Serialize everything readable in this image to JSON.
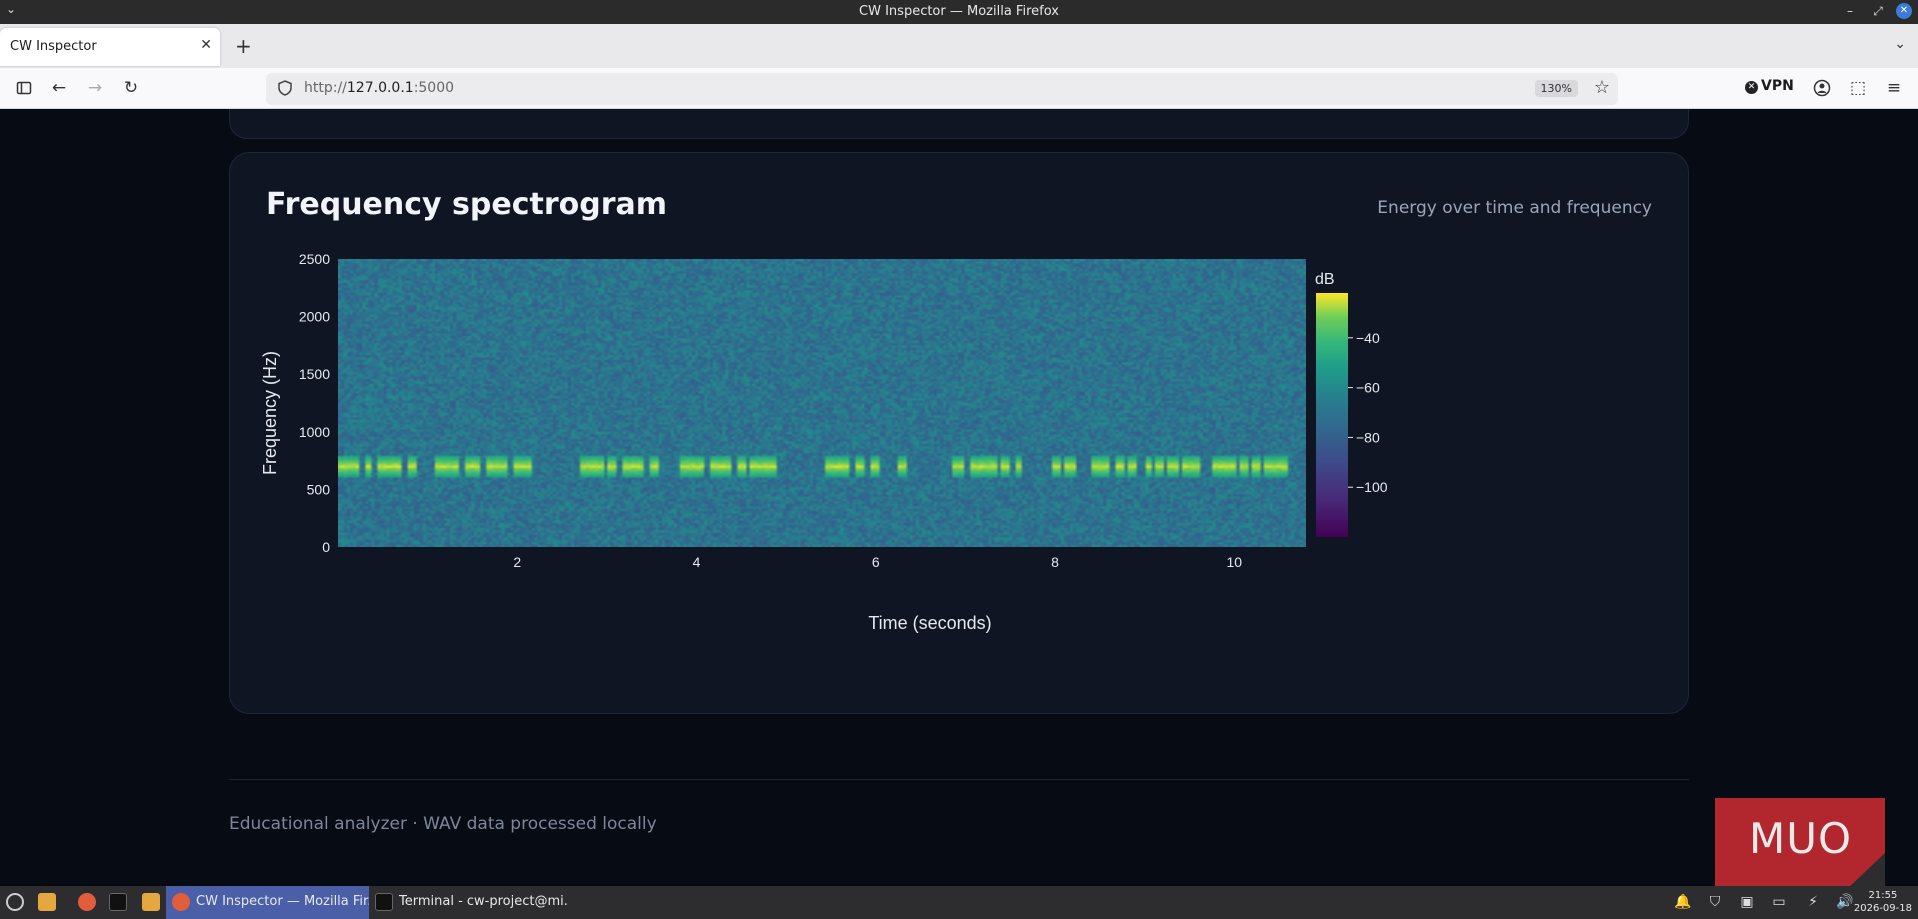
{
  "window": {
    "title": "CW Inspector — Mozilla Firefox"
  },
  "browser": {
    "tab_title": "CW Inspector",
    "url_scheme": "http://",
    "url_host": "127.0.0.1",
    "url_rest": ":5000",
    "zoom": "130%",
    "vpn_label": "VPN"
  },
  "card": {
    "title": "Frequency spectrogram",
    "subtitle": "Energy over time and frequency"
  },
  "chart_data": {
    "type": "heatmap",
    "xlabel": "Time (seconds)",
    "ylabel": "Frequency (Hz)",
    "xlim": [
      0,
      10.8
    ],
    "ylim": [
      0,
      2500
    ],
    "x_ticks": [
      2,
      4,
      6,
      8,
      10
    ],
    "y_ticks": [
      0,
      500,
      1000,
      1500,
      2000,
      2500
    ],
    "colorbar": {
      "label": "dB",
      "ticks": [
        -40,
        -60,
        -80,
        -100
      ],
      "range": [
        -120,
        -22
      ],
      "colormap": "viridis"
    },
    "tone_frequency_hz": 700,
    "tone_band_hz": [
      600,
      800
    ],
    "background_level_db": -70,
    "tone_level_db": -25,
    "tone_segments_seconds": [
      [
        0.0,
        0.22
      ],
      [
        0.3,
        0.38
      ],
      [
        0.45,
        0.72
      ],
      [
        0.76,
        0.88
      ],
      [
        1.08,
        1.35
      ],
      [
        1.42,
        1.6
      ],
      [
        1.65,
        1.88
      ],
      [
        1.95,
        2.15
      ],
      [
        2.7,
        2.98
      ],
      [
        3.02,
        3.12
      ],
      [
        3.17,
        3.42
      ],
      [
        3.48,
        3.58
      ],
      [
        3.82,
        4.1
      ],
      [
        4.14,
        4.4
      ],
      [
        4.46,
        4.55
      ],
      [
        4.6,
        4.88
      ],
      [
        5.42,
        5.72
      ],
      [
        5.78,
        5.88
      ],
      [
        5.95,
        6.05
      ],
      [
        6.25,
        6.33
      ],
      [
        6.85,
        6.98
      ],
      [
        7.05,
        7.35
      ],
      [
        7.4,
        7.5
      ],
      [
        7.56,
        7.64
      ],
      [
        7.95,
        8.05
      ],
      [
        8.1,
        8.22
      ],
      [
        8.42,
        8.62
      ],
      [
        8.66,
        8.76
      ],
      [
        8.8,
        8.9
      ],
      [
        9.0,
        9.08
      ],
      [
        9.12,
        9.2
      ],
      [
        9.25,
        9.38
      ],
      [
        9.42,
        9.62
      ],
      [
        9.75,
        10.02
      ],
      [
        10.06,
        10.15
      ],
      [
        10.2,
        10.28
      ],
      [
        10.32,
        10.6
      ]
    ]
  },
  "footer": {
    "text": "Educational analyzer · WAV data processed locally"
  },
  "watermark": {
    "text": "MUO"
  },
  "taskbar": {
    "task_firefox": "CW Inspector — Mozilla Fir...",
    "task_terminal": "Terminal - cw-project@mi...",
    "time": "21:55",
    "date": "2026-09-18"
  },
  "colors": {
    "page_bg": "#070b14",
    "card_bg": "#0f1523",
    "active_task": "#4a5fa8",
    "watermark": "#b2272d"
  }
}
